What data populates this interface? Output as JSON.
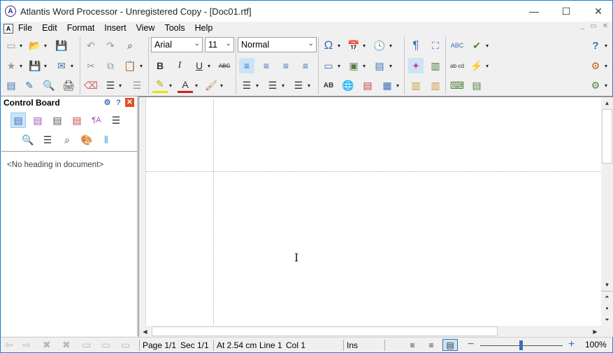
{
  "window": {
    "title": "Atlantis Word Processor - Unregistered Copy - [Doc01.rtf]",
    "app_logo_glyph": "A",
    "minimize_glyph": "—",
    "maximize_glyph": "☐",
    "close_glyph": "✕"
  },
  "menu": {
    "doc_icon_glyph": "A",
    "items": [
      "File",
      "Edit",
      "Format",
      "Insert",
      "View",
      "Tools",
      "Help"
    ],
    "mdi_controls": [
      "_",
      "▭",
      "✕"
    ]
  },
  "toolbar": {
    "font_name": "Arial",
    "font_size": "11",
    "style": "Normal",
    "dropdown_glyph": "▾",
    "icons": {
      "new": "▭",
      "open": "📂",
      "save": "💾",
      "favorites": "★",
      "save_as": "💾",
      "email": "✉",
      "templates": "▤",
      "edit": "✎",
      "preview": "🔍",
      "print": "🖨",
      "undo": "↶",
      "redo": "↷",
      "find": "⌕",
      "cut": "✂",
      "copy": "⧉",
      "paste": "📋",
      "eraser": "⌫",
      "align_lines": "☰",
      "format_painter": "⚙",
      "bold": "B",
      "italic": "I",
      "underline": "U",
      "strike": "ABC",
      "highlight": "✎",
      "font_color": "A",
      "brush": "🖌",
      "align_left": "≡",
      "align_center": "≡",
      "align_right": "≡",
      "justify": "≡",
      "bullets": "☰",
      "numbering": "☰",
      "multilevel": "☰",
      "symbol": "Ω",
      "date": "📅",
      "clock": "🕓",
      "frame": "▭",
      "picture": "▣",
      "page_insert": "▤",
      "caps": "AB",
      "globe": "🌐",
      "hyperlink": "▤",
      "table": "▦",
      "pilcrow": "¶",
      "fullscreen": "⛶",
      "layout": "✦",
      "ruler": "▥",
      "ruler_h": "▥",
      "ruler_v": "▥",
      "spell": "ABC",
      "autocorrect": "✔",
      "hyphen": "ab-cd",
      "lightning": "⚡",
      "keyboard": "⌨",
      "notes": "▤",
      "help": "?",
      "options": "⚙",
      "settings": "⚙"
    }
  },
  "control_board": {
    "title": "Control Board",
    "icons_row1": [
      "▤",
      "▤",
      "▤",
      "▤",
      "¶A",
      "☰"
    ],
    "icons_row2": [
      "🔍",
      "☰",
      "⌕",
      "🎨",
      "⫴"
    ],
    "header_icons": {
      "settings": "⚙",
      "help": "?",
      "close": "✕"
    },
    "placeholder": "<No heading in document>"
  },
  "scrollbars": {
    "up": "▲",
    "down": "▼",
    "left": "◀",
    "right": "▶",
    "page_up": "⏶",
    "browse": "●",
    "page_down": "⏷"
  },
  "statusbar": {
    "page": "Page 1/1",
    "section": "Sec 1/1",
    "position": "At 2.54 cm",
    "line": "Line 1",
    "col": "Col 1",
    "mode": "Ins",
    "zoom": "100%",
    "zoom_minus": "−",
    "zoom_plus": "+",
    "nav_glyphs": [
      "⇦",
      "⇨",
      "✖",
      "✖",
      "▭",
      "▭",
      "▭"
    ],
    "view_glyphs": [
      "≡",
      "≡",
      "▤"
    ]
  },
  "document": {
    "cursor_glyph": "I"
  },
  "colors": {
    "accent": "#3b6fb6",
    "window_border": "#1883d7",
    "selected_bg": "#cce4f7",
    "close_red": "#e0502a"
  }
}
